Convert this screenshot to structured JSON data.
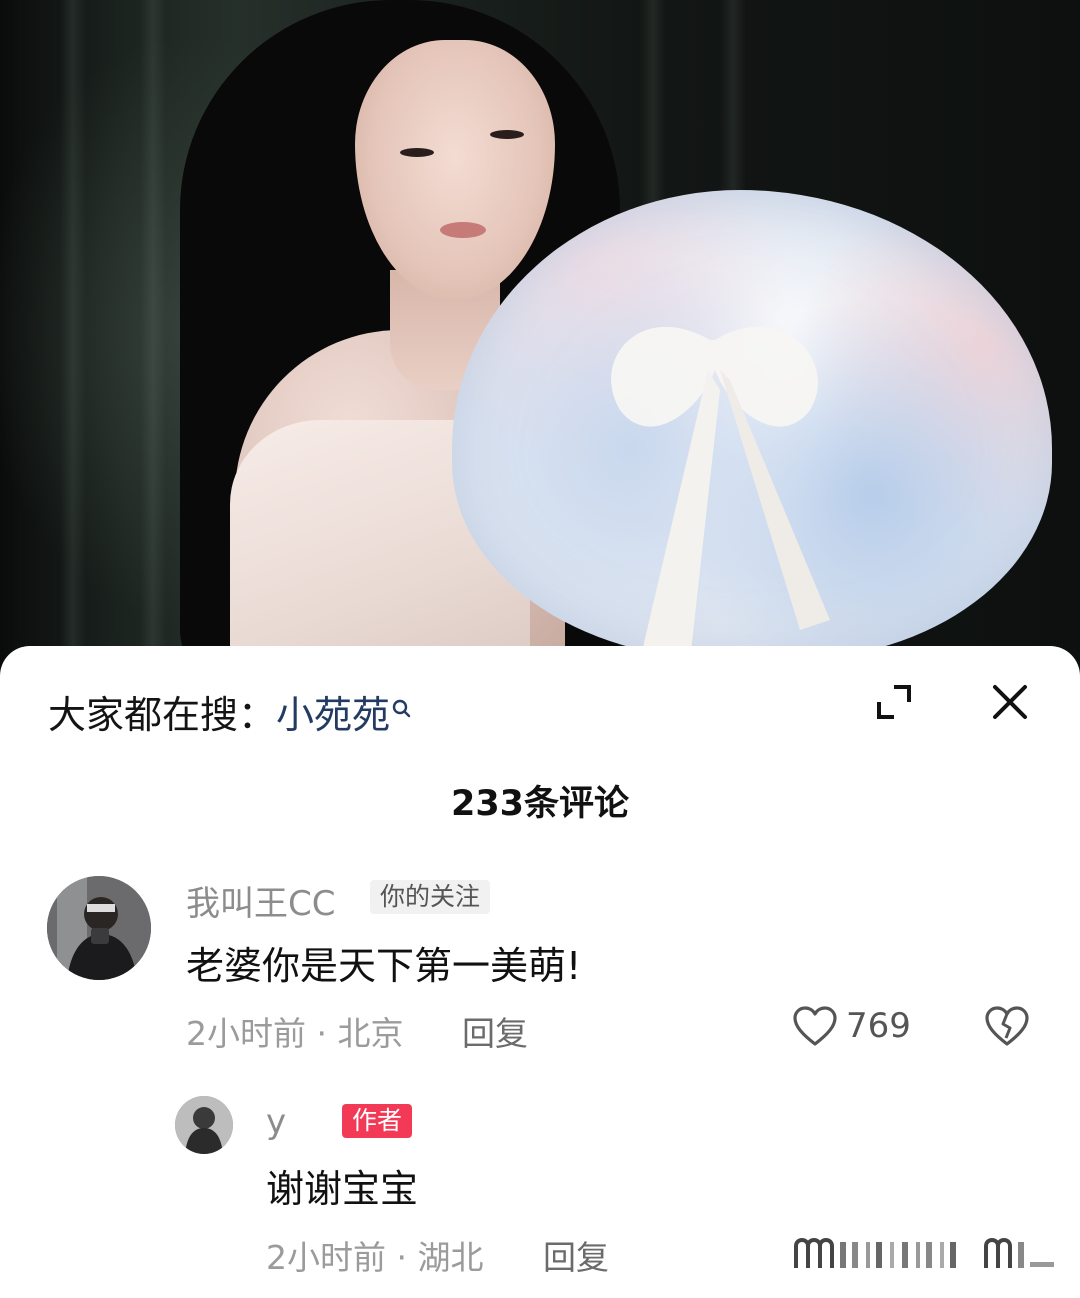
{
  "sheet": {
    "search_prefix": "大家都在搜：",
    "search_term": "小苑苑",
    "comment_count": "233条评论"
  },
  "comments": [
    {
      "username": "我叫王CC",
      "badge": "你的关注",
      "text": "老婆你是天下第一美萌!",
      "meta": "2小时前 · 北京",
      "reply_label": "回复",
      "likes": "769"
    },
    {
      "username": "y",
      "badge": "作者",
      "text": "谢谢宝宝",
      "meta": "2小时前 · 湖北",
      "reply_label": "回复"
    }
  ],
  "colors": {
    "search_term": "#233b63",
    "author_badge": "#f23a57",
    "sheet_bg": "#ffffff"
  },
  "icons": {
    "search": "search-icon",
    "expand": "expand-icon",
    "close": "close-icon",
    "like": "heart-icon",
    "dislike": "broken-heart-icon"
  }
}
